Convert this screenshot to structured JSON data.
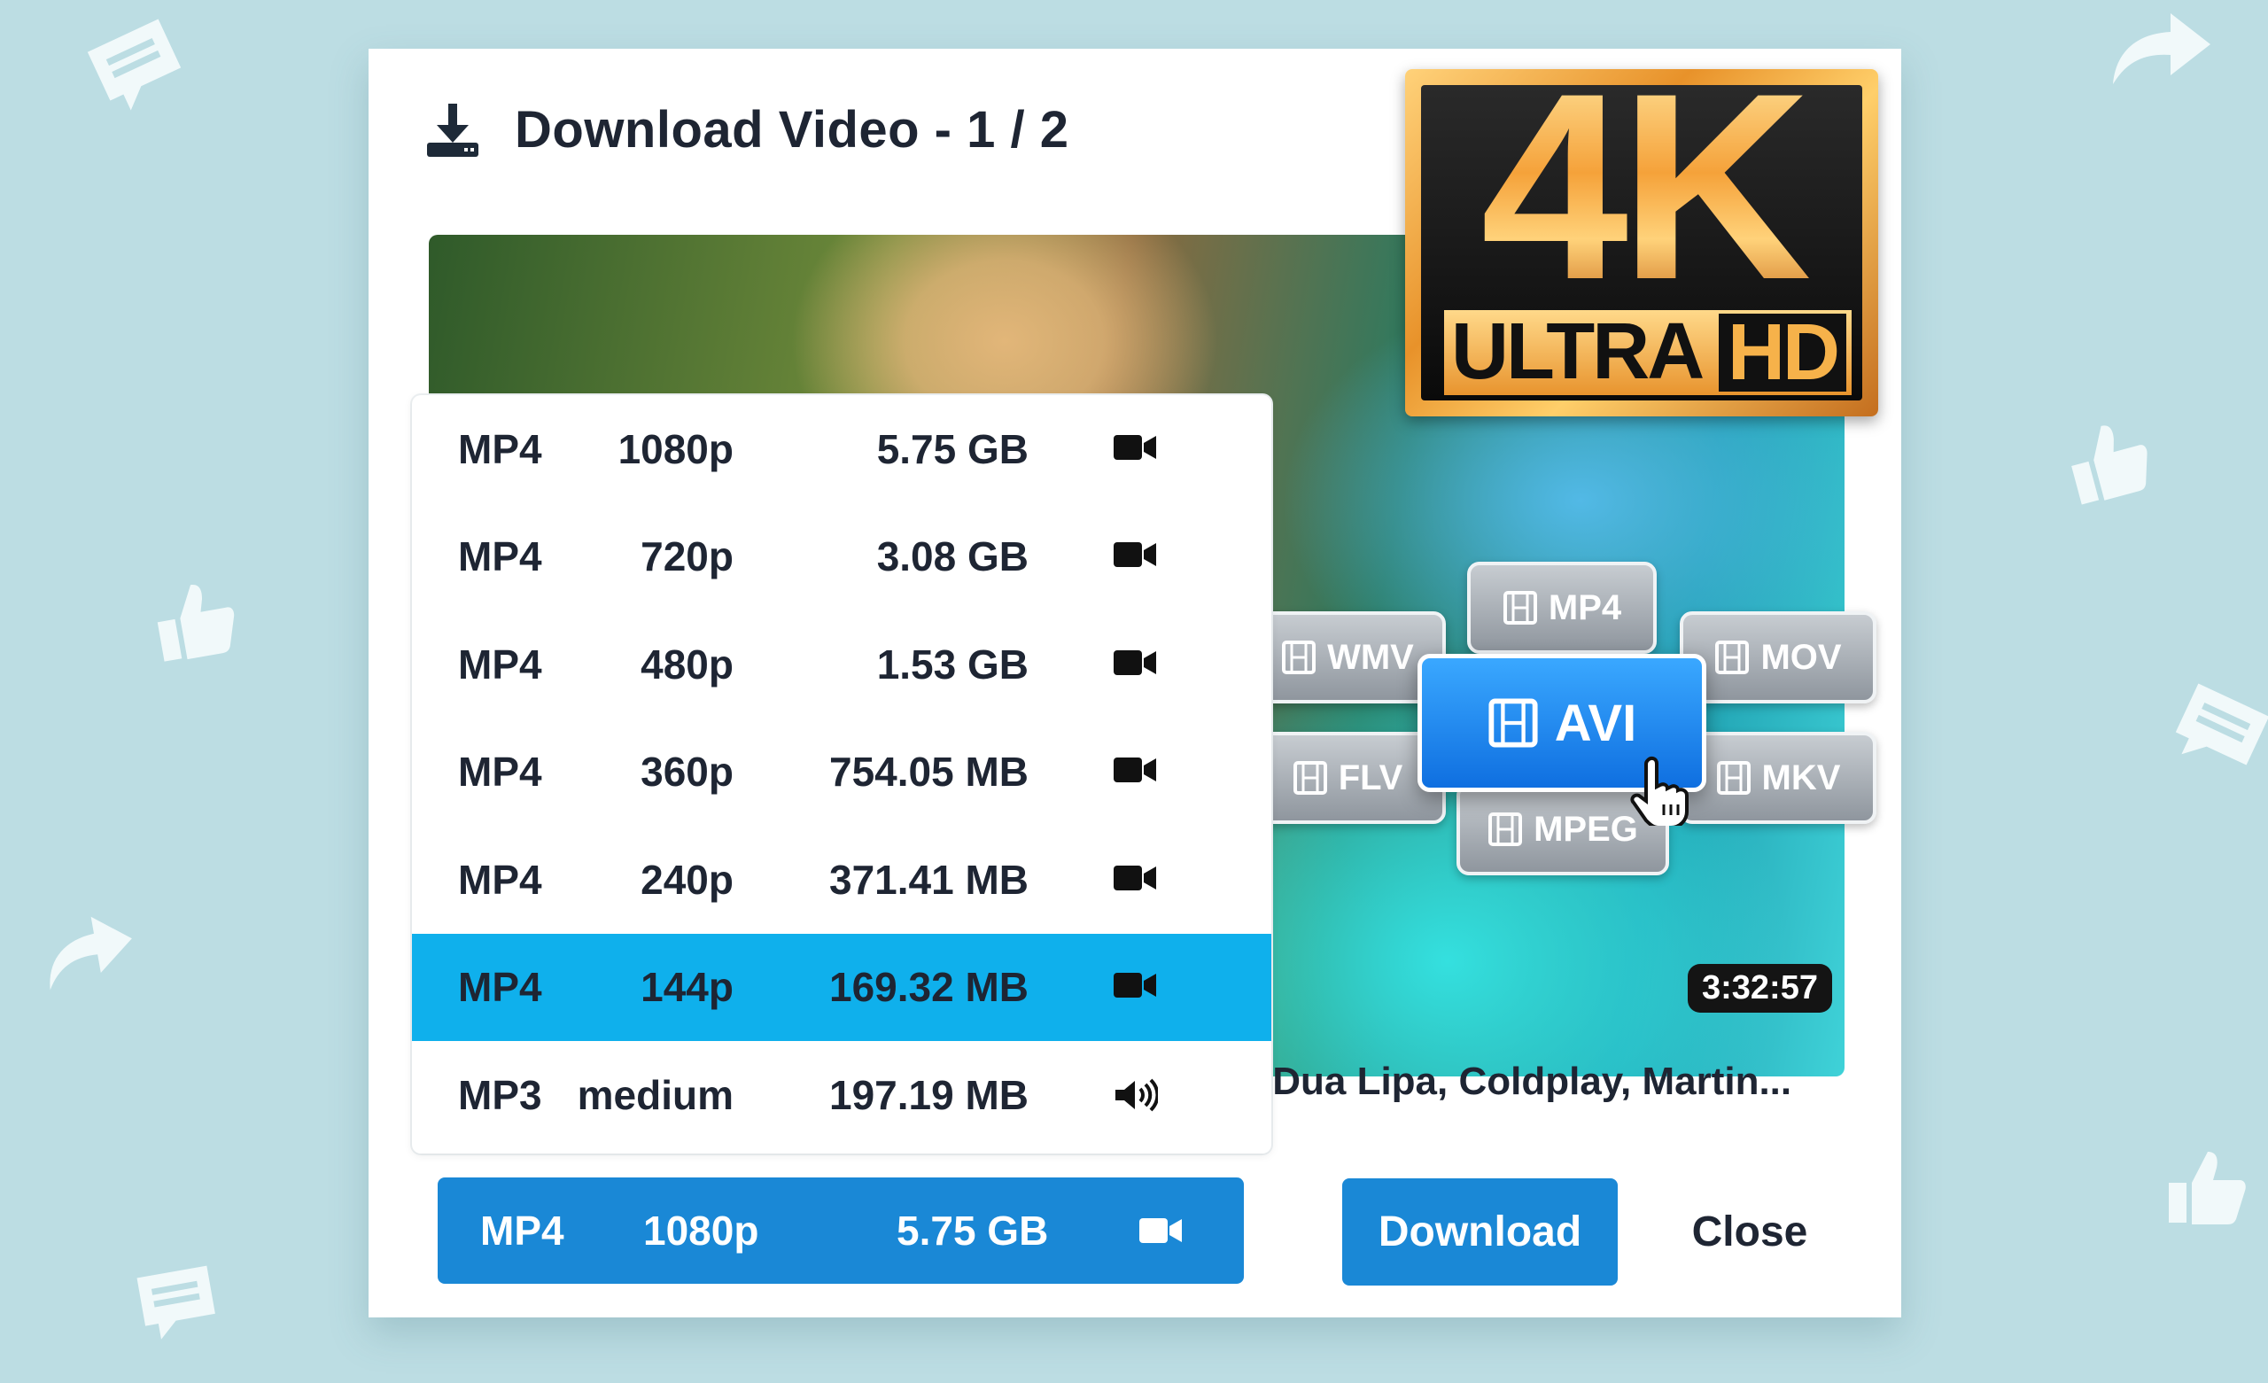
{
  "dialog": {
    "title": "Download Video - 1 / 2",
    "duration": "3:32:57",
    "caption": ",Dua Lipa, Coldplay, Martin..."
  },
  "formats": [
    {
      "format": "MP4",
      "resolution": "1080p",
      "size": "5.75 GB",
      "icon": "video-camera-icon"
    },
    {
      "format": "MP4",
      "resolution": "720p",
      "size": "3.08 GB",
      "icon": "video-camera-icon"
    },
    {
      "format": "MP4",
      "resolution": "480p",
      "size": "1.53 GB",
      "icon": "video-camera-icon"
    },
    {
      "format": "MP4",
      "resolution": "360p",
      "size": "754.05 MB",
      "icon": "video-camera-icon"
    },
    {
      "format": "MP4",
      "resolution": "240p",
      "size": "371.41 MB",
      "icon": "video-camera-icon"
    },
    {
      "format": "MP4",
      "resolution": "144p",
      "size": "169.32 MB",
      "icon": "video-camera-icon",
      "highlighted": true
    },
    {
      "format": "MP3",
      "resolution": "medium",
      "size": "197.19 MB",
      "icon": "speaker-icon"
    }
  ],
  "selected": {
    "format": "MP4",
    "resolution": "1080p",
    "size": "5.75 GB",
    "icon": "video-camera-icon"
  },
  "buttons": {
    "download": "Download",
    "close": "Close"
  },
  "badge": {
    "big": "4K",
    "ultra": "ULTRA",
    "hd": "HD"
  },
  "format_chips": [
    "MP4",
    "WMV",
    "MOV",
    "AVI",
    "FLV",
    "MKV",
    "MPEG"
  ],
  "colors": {
    "accent": "#1a88d6",
    "highlight_row": "#0fb0ec",
    "background": "#bcdde3",
    "chip_active": "#1f8cf0"
  }
}
